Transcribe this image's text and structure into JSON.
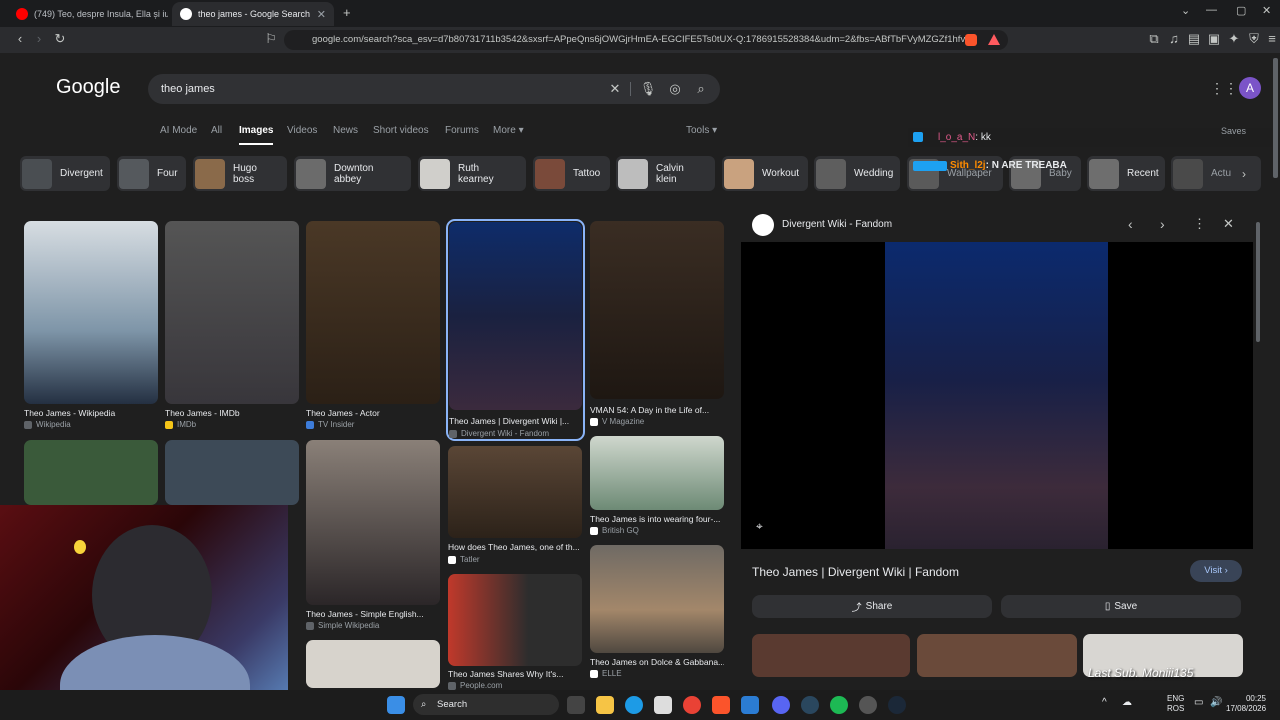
{
  "browser": {
    "tabs": [
      {
        "title": "(749) Teo, despre Insula, Ella și iu"
      },
      {
        "title": "theo james - Google Search"
      }
    ],
    "url": "google.com/search?sca_esv=d7b80731711b3542&sxsrf=APpeQns6jOWGjrHmEA-EGCIFE5Ts0tUX-Q:1786915528384&udm=2&fbs=ABfTbFVyMZGZf1hfv..."
  },
  "google": {
    "logo": "Google",
    "query": "theo james",
    "avatar_letter": "A",
    "tabs": [
      "AI Mode",
      "All",
      "Images",
      "Videos",
      "News",
      "Short videos",
      "Forums",
      "More"
    ],
    "tools_label": "Tools",
    "chips": [
      "Divergent",
      "Four",
      "Hugo boss",
      "Downton abbey",
      "Ruth kearney",
      "Tattoo",
      "Calvin klein",
      "Workout",
      "Wedding",
      "Wallpaper",
      "Baby",
      "Recent",
      "Actu"
    ],
    "saves_label": "Saves",
    "results": [
      {
        "title": "Theo James - Wikipedia",
        "source": "Wikipedia"
      },
      {
        "title": "Theo James - IMDb",
        "source": "IMDb"
      },
      {
        "title": "Theo James - Actor",
        "source": "TV Insider"
      },
      {
        "title": "Theo James | Divergent Wiki |...",
        "source": "Divergent Wiki - Fandom"
      },
      {
        "title": "VMAN 54: A Day in the Life of...",
        "source": "V Magazine"
      },
      {
        "title": "How does Theo James, one of th...",
        "source": "Tatler"
      },
      {
        "title": "Theo James is into wearing four-...",
        "source": "British GQ"
      },
      {
        "title": "Theo James - Simple English...",
        "source": "Simple Wikipedia"
      },
      {
        "title": "Theo James Shares Why It's...",
        "source": "People.com"
      },
      {
        "title": "Theo James on Dolce & Gabbana...",
        "source": "ELLE"
      }
    ]
  },
  "panel": {
    "source": "Divergent Wiki - Fandom",
    "title": "Theo James | Divergent Wiki | Fandom",
    "visit_label": "Visit",
    "share_label": "Share",
    "save_label": "Save"
  },
  "stream": {
    "chat": [
      {
        "user": "l_o_a_N",
        "message": "kk",
        "color": "#e05a8a"
      },
      {
        "user": "Sith_l2j",
        "message": "N ARE TREABA",
        "color": "#ff8c00"
      }
    ],
    "last_sub": "Last Sub. Moniii135"
  },
  "taskbar": {
    "search_label": "Search",
    "lang": "ENG",
    "lang2": "ROS",
    "time": "00:25",
    "date": "17/08/2026"
  }
}
